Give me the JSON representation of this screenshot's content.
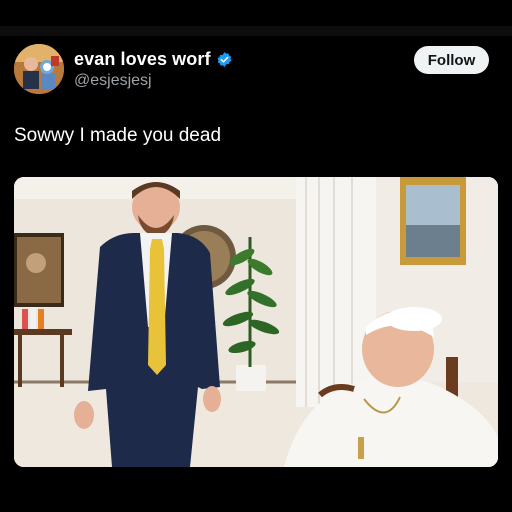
{
  "post": {
    "author": {
      "display_name": "evan loves worf",
      "handle": "@esjesjesj",
      "verified": true,
      "verified_icon": "verified-badge-icon"
    },
    "follow_label": "Follow",
    "text": "Sowwy I made you dead",
    "media": {
      "kind": "photo"
    }
  },
  "colors": {
    "background": "#000000",
    "verified_blue": "#1d9bf0",
    "follow_button_bg": "#eff3f4",
    "handle_gray": "#9ea3a8"
  }
}
